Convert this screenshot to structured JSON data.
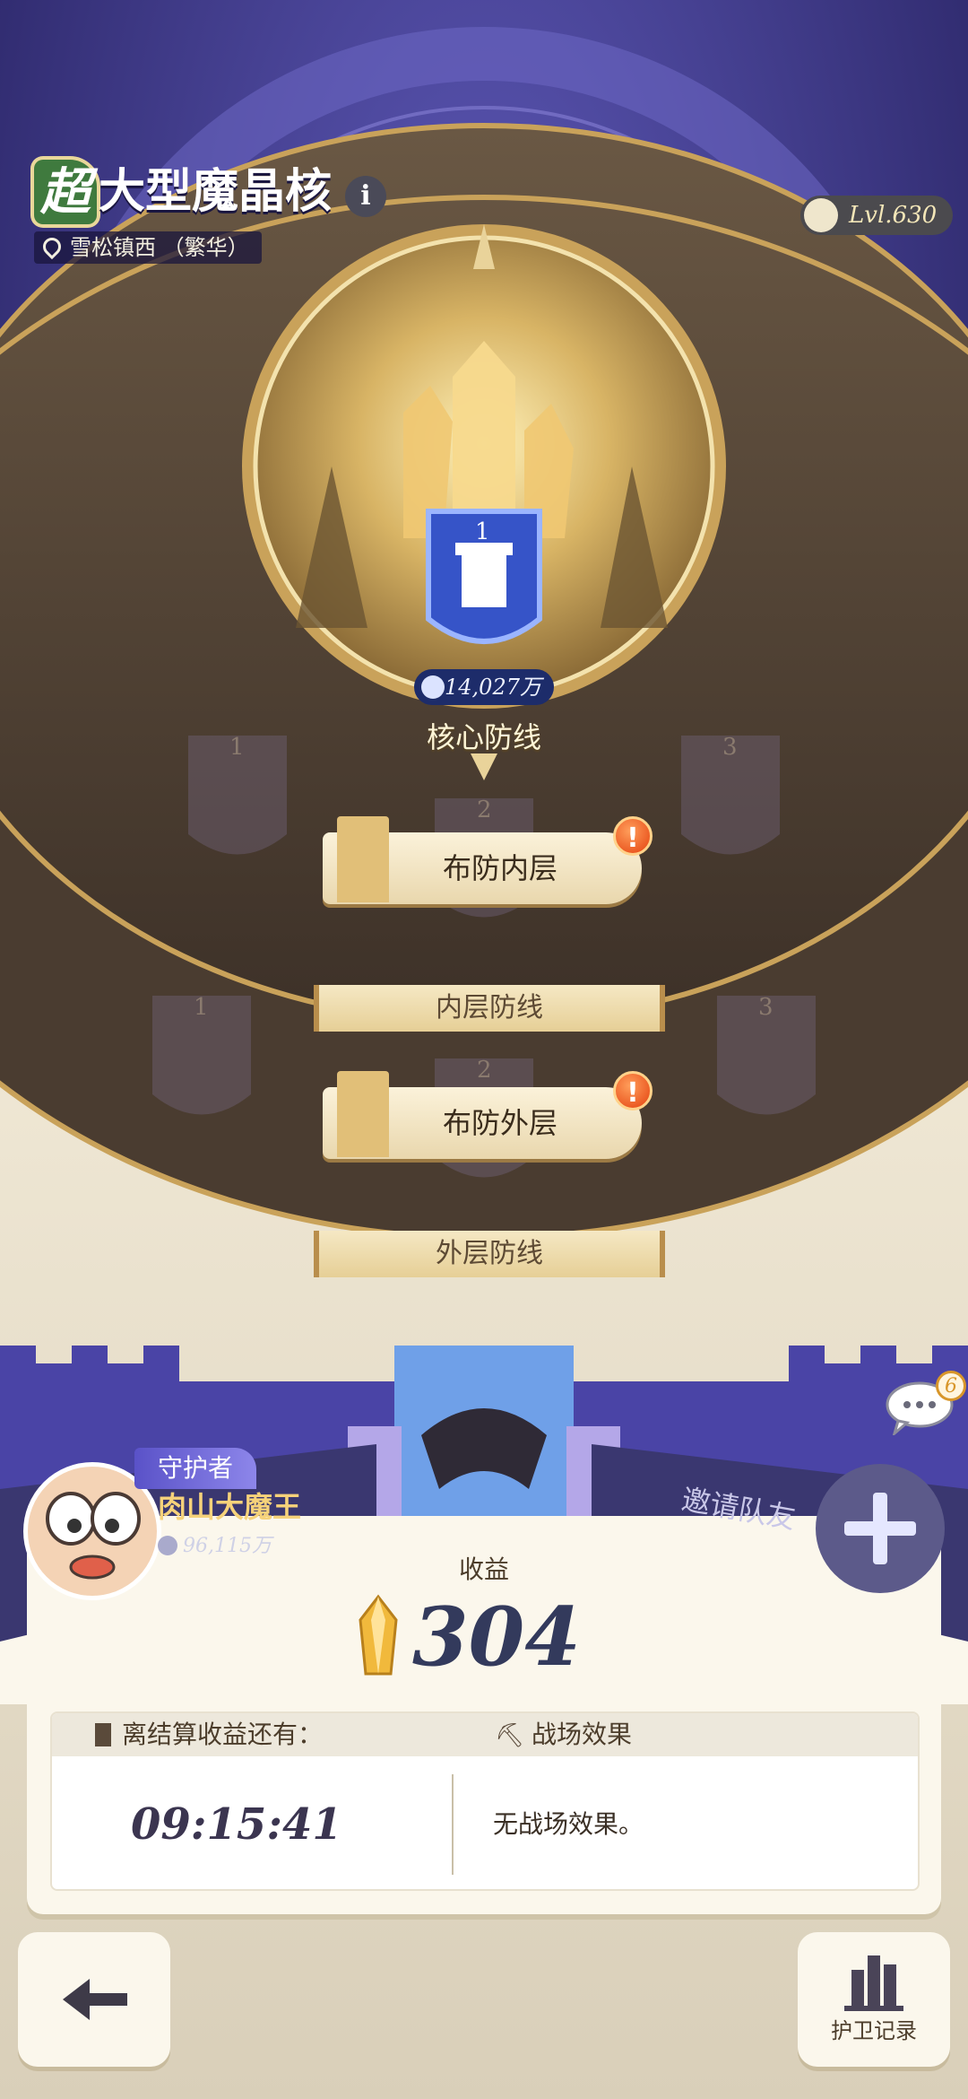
{
  "header": {
    "badge": "超",
    "title": "大型魔晶核",
    "info_icon": "i",
    "location": "雪松镇西  （繁华）",
    "level": "Lvl.630"
  },
  "core": {
    "shield_number": "1",
    "power": "14,027万",
    "label": "核心防线"
  },
  "inner": {
    "slots": [
      "1",
      "2",
      "3"
    ],
    "button": "布防内层",
    "label": "内层防线"
  },
  "outer": {
    "slots": [
      "1",
      "2",
      "3"
    ],
    "button": "布防外层",
    "label": "外层防线"
  },
  "guardian": {
    "tag": "守护者",
    "name": "肉山大魔王",
    "power": "96,115万"
  },
  "invite_label": "邀请队友",
  "chat_badge": "6",
  "income": {
    "label": "收益",
    "value": "304"
  },
  "info": {
    "timer_header": "离结算收益还有：",
    "effect_header": "战场效果",
    "timer": "09:15:41",
    "effect_text": "无战场效果。"
  },
  "buttons": {
    "records": "护卫记录"
  },
  "colors": {
    "sky": "#2b2766",
    "ground": "#5a4a3a",
    "accent_gold": "#e1bf78",
    "alert": "#e4420f"
  }
}
